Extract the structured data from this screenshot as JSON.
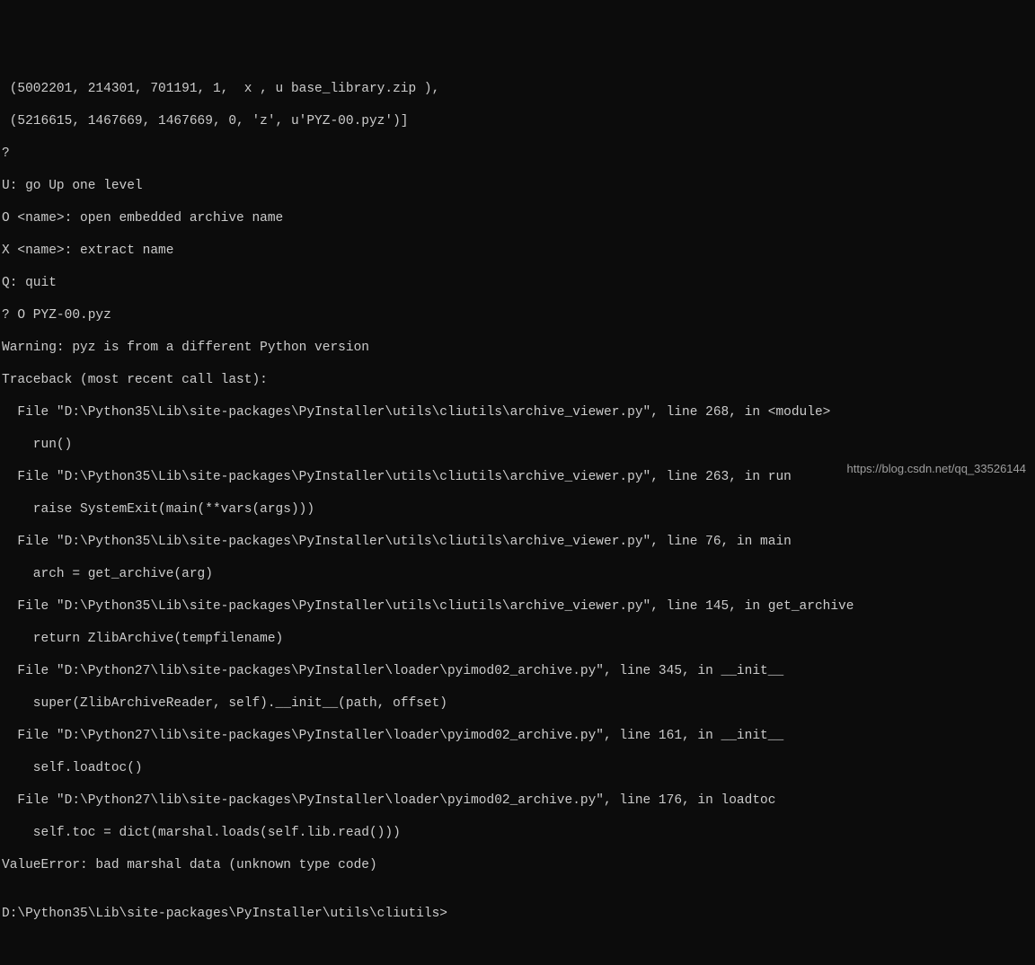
{
  "lines": [
    " (5002201, 214301, 701191, 1,  x , u base_library.zip ),",
    " (5216615, 1467669, 1467669, 0, 'z', u'PYZ-00.pyz')]",
    "?",
    "U: go Up one level",
    "O <name>: open embedded archive name",
    "X <name>: extract name",
    "Q: quit",
    "? O PYZ-00.pyz",
    "Warning: pyz is from a different Python version",
    "Traceback (most recent call last):",
    "  File \"D:\\Python35\\Lib\\site-packages\\PyInstaller\\utils\\cliutils\\archive_viewer.py\", line 268, in <module>",
    "    run()",
    "  File \"D:\\Python35\\Lib\\site-packages\\PyInstaller\\utils\\cliutils\\archive_viewer.py\", line 263, in run",
    "    raise SystemExit(main(**vars(args)))",
    "  File \"D:\\Python35\\Lib\\site-packages\\PyInstaller\\utils\\cliutils\\archive_viewer.py\", line 76, in main",
    "    arch = get_archive(arg)",
    "  File \"D:\\Python35\\Lib\\site-packages\\PyInstaller\\utils\\cliutils\\archive_viewer.py\", line 145, in get_archive",
    "    return ZlibArchive(tempfilename)",
    "  File \"D:\\Python27\\lib\\site-packages\\PyInstaller\\loader\\pyimod02_archive.py\", line 345, in __init__",
    "    super(ZlibArchiveReader, self).__init__(path, offset)",
    "  File \"D:\\Python27\\lib\\site-packages\\PyInstaller\\loader\\pyimod02_archive.py\", line 161, in __init__",
    "    self.loadtoc()",
    "  File \"D:\\Python27\\lib\\site-packages\\PyInstaller\\loader\\pyimod02_archive.py\", line 176, in loadtoc",
    "    self.toc = dict(marshal.loads(self.lib.read()))",
    "ValueError: bad marshal data (unknown type code)",
    "",
    "D:\\Python35\\Lib\\site-packages\\PyInstaller\\utils\\cliutils>"
  ],
  "watermark": "https://blog.csdn.net/qq_33526144"
}
